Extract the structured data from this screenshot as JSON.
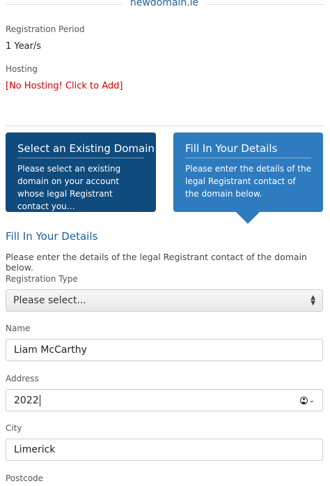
{
  "domain": "newdomain.ie",
  "registration_period": {
    "label": "Registration Period",
    "value": "1 Year/s"
  },
  "hosting": {
    "label": "Hosting",
    "link": "[No Hosting! Click to Add]"
  },
  "options": {
    "existing": {
      "title": "Select an Existing Domain",
      "description": "Please select an existing domain on your account whose legal Registrant contact you…"
    },
    "fill": {
      "title": "Fill In Your Details",
      "description": "Please enter the details of the legal Registrant contact of the domain below."
    }
  },
  "details": {
    "title": "Fill In Your Details",
    "description": "Please enter the details of the legal Registrant contact of the domain below."
  },
  "form": {
    "registration_type": {
      "label": "Registration Type",
      "value": "Please select..."
    },
    "name": {
      "label": "Name",
      "value": "Liam McCarthy"
    },
    "address": {
      "label": "Address",
      "value": "2022"
    },
    "city": {
      "label": "City",
      "value": "Limerick"
    },
    "postcode": {
      "label": "Postcode"
    }
  },
  "colors": {
    "accent": "#1f5f99",
    "card_dark": "#0f4b7d",
    "card_light": "#2e7cbf",
    "link_red": "#cc0000"
  },
  "icons": {
    "autofill": "contact-autofill-icon",
    "select": "updown-arrows-icon"
  }
}
